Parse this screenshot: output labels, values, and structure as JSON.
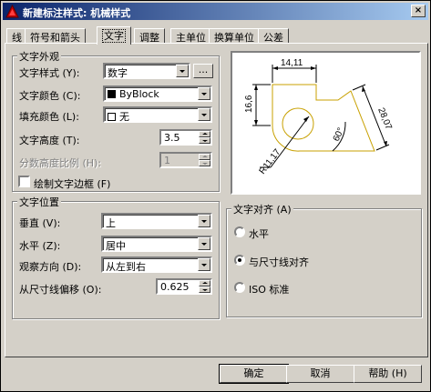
{
  "window": {
    "title": "新建标注样式: 机械样式",
    "close_label": "×"
  },
  "tabs": [
    {
      "label": "线"
    },
    {
      "label": "符号和箭头"
    },
    {
      "label": "文字"
    },
    {
      "label": "调整"
    },
    {
      "label": "主单位"
    },
    {
      "label": "换算单位"
    },
    {
      "label": "公差"
    }
  ],
  "text_appearance": {
    "group_label": "文字外观",
    "text_style": {
      "label": "文字样式 (Y):",
      "value": "数字",
      "browse_label": "..."
    },
    "text_color": {
      "label": "文字颜色 (C):",
      "value": "ByBlock"
    },
    "fill_color": {
      "label": "填充颜色 (L):",
      "value": "无"
    },
    "text_height": {
      "label": "文字高度 (T):",
      "value": "3.5"
    },
    "fraction_scale": {
      "label": "分数高度比例 (H):",
      "value": "1"
    },
    "draw_frame": {
      "label": "绘制文字边框 (F)",
      "checked": false
    }
  },
  "text_placement": {
    "group_label": "文字位置",
    "vertical": {
      "label": "垂直 (V):",
      "value": "上"
    },
    "horizontal": {
      "label": "水平 (Z):",
      "value": "居中"
    },
    "view_direction": {
      "label": "观察方向 (D):",
      "value": "从左到右"
    },
    "offset": {
      "label": "从尺寸线偏移 (O):",
      "value": "0.625"
    }
  },
  "text_alignment": {
    "group_label": "文字对齐 (A)",
    "options": [
      {
        "label": "水平",
        "checked": false
      },
      {
        "label": "与尺寸线对齐",
        "checked": true
      },
      {
        "label": "ISO 标准",
        "checked": false
      }
    ]
  },
  "preview": {
    "dim_top": "14,11",
    "dim_left": "16,6",
    "dim_right": "28,07",
    "dim_angle": "60°",
    "dim_radius": "R11,17"
  },
  "buttons": {
    "ok": "确定",
    "cancel": "取消",
    "help": "帮助 (H)"
  },
  "colors": {
    "title_start": "#0a246a",
    "title_end": "#a6caf0",
    "face": "#d4d0c8",
    "preview_part": "#c8a000"
  }
}
